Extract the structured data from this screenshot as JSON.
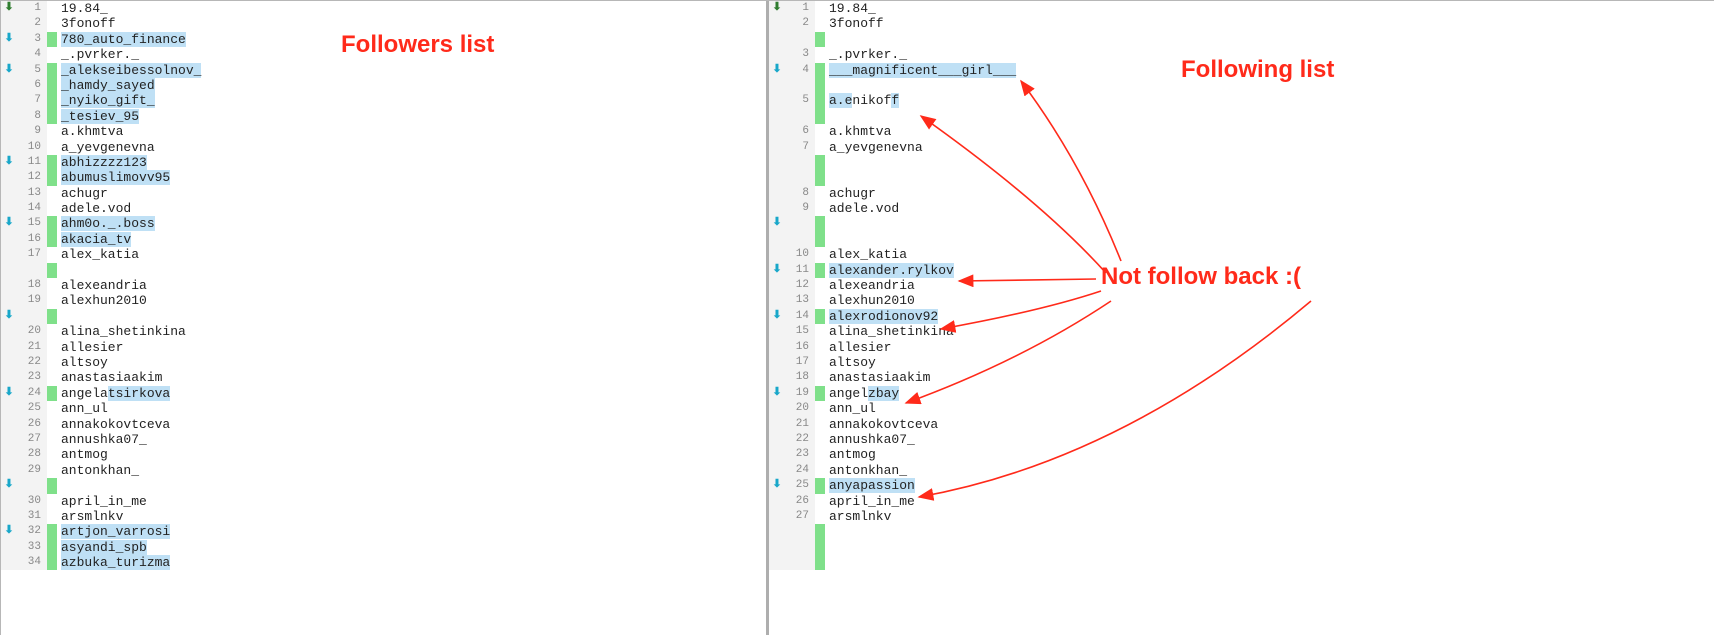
{
  "annotations": {
    "followers_title": "Followers list",
    "following_title": "Following list",
    "not_follow_back": "Not follow back :("
  },
  "left": {
    "rows": [
      {
        "n": 1,
        "mark": "down-green",
        "bar": false,
        "segs": [
          [
            "19.84_",
            false
          ]
        ]
      },
      {
        "n": 2,
        "mark": "",
        "bar": false,
        "segs": [
          [
            "3fonoff",
            false
          ]
        ]
      },
      {
        "n": 3,
        "mark": "down-cyan",
        "bar": true,
        "segs": [
          [
            "780_auto_finance",
            true
          ]
        ]
      },
      {
        "n": 4,
        "mark": "",
        "bar": false,
        "segs": [
          [
            "_.pvrker._",
            false
          ]
        ]
      },
      {
        "n": 5,
        "mark": "down-cyan",
        "bar": true,
        "segs": [
          [
            "_alekseibessolnov_",
            true
          ]
        ]
      },
      {
        "n": 6,
        "mark": "",
        "bar": true,
        "segs": [
          [
            "_hamdy_sayed",
            true
          ]
        ]
      },
      {
        "n": 7,
        "mark": "",
        "bar": true,
        "segs": [
          [
            "_nyiko_gift_",
            true
          ]
        ]
      },
      {
        "n": 8,
        "mark": "",
        "bar": true,
        "segs": [
          [
            "_tesiev_95",
            true
          ]
        ]
      },
      {
        "n": 9,
        "mark": "",
        "bar": false,
        "segs": [
          [
            "a.khmtva",
            false
          ]
        ]
      },
      {
        "n": 10,
        "mark": "",
        "bar": false,
        "segs": [
          [
            "a_yevgenevna",
            false
          ]
        ]
      },
      {
        "n": 11,
        "mark": "down-cyan",
        "bar": true,
        "segs": [
          [
            "abhizzzz123",
            true
          ]
        ]
      },
      {
        "n": 12,
        "mark": "",
        "bar": true,
        "segs": [
          [
            "abumuslimovv95",
            true
          ]
        ]
      },
      {
        "n": 13,
        "mark": "",
        "bar": false,
        "segs": [
          [
            "achugr",
            false
          ]
        ]
      },
      {
        "n": 14,
        "mark": "",
        "bar": false,
        "segs": [
          [
            "adele.vod",
            false
          ]
        ]
      },
      {
        "n": 15,
        "mark": "down-cyan",
        "bar": true,
        "segs": [
          [
            "ahm0o._.boss",
            true
          ]
        ]
      },
      {
        "n": 16,
        "mark": "",
        "bar": true,
        "segs": [
          [
            "akacia_tv",
            true
          ]
        ]
      },
      {
        "n": 17,
        "mark": "",
        "bar": false,
        "segs": [
          [
            "alex_katia",
            false
          ]
        ]
      },
      {
        "n": -1,
        "mark": "",
        "bar": true,
        "segs": [
          [
            "",
            false
          ]
        ]
      },
      {
        "n": 18,
        "mark": "",
        "bar": false,
        "segs": [
          [
            "alexeandria",
            false
          ]
        ]
      },
      {
        "n": 19,
        "mark": "",
        "bar": false,
        "segs": [
          [
            "alexhun2010",
            false
          ]
        ]
      },
      {
        "n": -1,
        "mark": "down-cyan",
        "bar": true,
        "segs": [
          [
            "",
            false
          ]
        ]
      },
      {
        "n": 20,
        "mark": "",
        "bar": false,
        "segs": [
          [
            "alina_shetinkina",
            false
          ]
        ]
      },
      {
        "n": 21,
        "mark": "",
        "bar": false,
        "segs": [
          [
            "allesier",
            false
          ]
        ]
      },
      {
        "n": 22,
        "mark": "",
        "bar": false,
        "segs": [
          [
            "altsoy",
            false
          ]
        ]
      },
      {
        "n": 23,
        "mark": "",
        "bar": false,
        "segs": [
          [
            "anastasiaakim",
            false
          ]
        ]
      },
      {
        "n": 24,
        "mark": "down-cyan",
        "bar": true,
        "segs": [
          [
            "angela",
            false
          ],
          [
            "tsirkova",
            true
          ]
        ]
      },
      {
        "n": 25,
        "mark": "",
        "bar": false,
        "segs": [
          [
            "ann_ul",
            false
          ]
        ]
      },
      {
        "n": 26,
        "mark": "",
        "bar": false,
        "segs": [
          [
            "annakokovtceva",
            false
          ]
        ]
      },
      {
        "n": 27,
        "mark": "",
        "bar": false,
        "segs": [
          [
            "annushka07_",
            false
          ]
        ]
      },
      {
        "n": 28,
        "mark": "",
        "bar": false,
        "segs": [
          [
            "antmog",
            false
          ]
        ]
      },
      {
        "n": 29,
        "mark": "",
        "bar": false,
        "segs": [
          [
            "antonkhan_",
            false
          ]
        ]
      },
      {
        "n": -1,
        "mark": "down-cyan",
        "bar": true,
        "segs": [
          [
            "",
            false
          ]
        ]
      },
      {
        "n": 30,
        "mark": "",
        "bar": false,
        "segs": [
          [
            "april_in_me",
            false
          ]
        ]
      },
      {
        "n": 31,
        "mark": "",
        "bar": false,
        "segs": [
          [
            "arsmlnkv",
            false
          ]
        ]
      },
      {
        "n": 32,
        "mark": "down-cyan",
        "bar": true,
        "segs": [
          [
            "artjon_varrosi",
            true
          ]
        ]
      },
      {
        "n": 33,
        "mark": "",
        "bar": true,
        "segs": [
          [
            "asyandi_spb",
            true
          ]
        ]
      },
      {
        "n": 34,
        "mark": "",
        "bar": true,
        "segs": [
          [
            "azbuka_turizma",
            true
          ]
        ]
      }
    ]
  },
  "right": {
    "rows": [
      {
        "n": 1,
        "mark": "down-green",
        "bar": false,
        "segs": [
          [
            "19.84_",
            false
          ]
        ]
      },
      {
        "n": 2,
        "mark": "",
        "bar": false,
        "segs": [
          [
            "3fonoff",
            false
          ]
        ]
      },
      {
        "n": -1,
        "mark": "",
        "bar": true,
        "segs": [
          [
            "",
            false
          ]
        ]
      },
      {
        "n": 3,
        "mark": "",
        "bar": false,
        "segs": [
          [
            "_.pvrker._",
            false
          ]
        ]
      },
      {
        "n": 4,
        "mark": "down-cyan",
        "bar": true,
        "segs": [
          [
            "___magnificent___girl___",
            true
          ]
        ]
      },
      {
        "n": -1,
        "mark": "",
        "bar": true,
        "segs": [
          [
            "",
            false
          ]
        ]
      },
      {
        "n": 5,
        "mark": "",
        "bar": true,
        "segs": [
          [
            "a.e",
            true
          ],
          [
            "nikof",
            false
          ],
          [
            "f",
            true
          ]
        ]
      },
      {
        "n": -1,
        "mark": "",
        "bar": true,
        "segs": [
          [
            "",
            false
          ]
        ]
      },
      {
        "n": 6,
        "mark": "",
        "bar": false,
        "segs": [
          [
            "a.khmtva",
            false
          ]
        ]
      },
      {
        "n": 7,
        "mark": "",
        "bar": false,
        "segs": [
          [
            "a_yevgenevna",
            false
          ]
        ]
      },
      {
        "n": -1,
        "mark": "",
        "bar": true,
        "segs": [
          [
            "",
            false
          ]
        ]
      },
      {
        "n": -1,
        "mark": "",
        "bar": true,
        "segs": [
          [
            "",
            false
          ]
        ]
      },
      {
        "n": 8,
        "mark": "",
        "bar": false,
        "segs": [
          [
            "achugr",
            false
          ]
        ]
      },
      {
        "n": 9,
        "mark": "",
        "bar": false,
        "segs": [
          [
            "adele.vod",
            false
          ]
        ]
      },
      {
        "n": -1,
        "mark": "down-cyan",
        "bar": true,
        "segs": [
          [
            "",
            false
          ]
        ]
      },
      {
        "n": -1,
        "mark": "",
        "bar": true,
        "segs": [
          [
            "",
            false
          ]
        ]
      },
      {
        "n": 10,
        "mark": "",
        "bar": false,
        "segs": [
          [
            "alex_katia",
            false
          ]
        ]
      },
      {
        "n": 11,
        "mark": "down-cyan",
        "bar": true,
        "segs": [
          [
            "alexander.rylkov",
            true
          ]
        ]
      },
      {
        "n": 12,
        "mark": "",
        "bar": false,
        "segs": [
          [
            "alexeandria",
            false
          ]
        ]
      },
      {
        "n": 13,
        "mark": "",
        "bar": false,
        "segs": [
          [
            "alexhun2010",
            false
          ]
        ]
      },
      {
        "n": 14,
        "mark": "down-cyan",
        "bar": true,
        "segs": [
          [
            "alexrodionov92",
            true
          ]
        ]
      },
      {
        "n": 15,
        "mark": "",
        "bar": false,
        "segs": [
          [
            "alina_shetinkina",
            false
          ]
        ]
      },
      {
        "n": 16,
        "mark": "",
        "bar": false,
        "segs": [
          [
            "allesier",
            false
          ]
        ]
      },
      {
        "n": 17,
        "mark": "",
        "bar": false,
        "segs": [
          [
            "altsoy",
            false
          ]
        ]
      },
      {
        "n": 18,
        "mark": "",
        "bar": false,
        "segs": [
          [
            "anastasiaakim",
            false
          ]
        ]
      },
      {
        "n": 19,
        "mark": "down-cyan",
        "bar": true,
        "segs": [
          [
            "angel",
            false
          ],
          [
            "zbay",
            true
          ]
        ]
      },
      {
        "n": 20,
        "mark": "",
        "bar": false,
        "segs": [
          [
            "ann_ul",
            false
          ]
        ]
      },
      {
        "n": 21,
        "mark": "",
        "bar": false,
        "segs": [
          [
            "annakokovtceva",
            false
          ]
        ]
      },
      {
        "n": 22,
        "mark": "",
        "bar": false,
        "segs": [
          [
            "annushka07_",
            false
          ]
        ]
      },
      {
        "n": 23,
        "mark": "",
        "bar": false,
        "segs": [
          [
            "antmog",
            false
          ]
        ]
      },
      {
        "n": 24,
        "mark": "",
        "bar": false,
        "segs": [
          [
            "antonkhan_",
            false
          ]
        ]
      },
      {
        "n": 25,
        "mark": "down-cyan",
        "bar": true,
        "segs": [
          [
            "anyapassion",
            true
          ]
        ]
      },
      {
        "n": 26,
        "mark": "",
        "bar": false,
        "segs": [
          [
            "april_in_me",
            false
          ]
        ]
      },
      {
        "n": 27,
        "mark": "",
        "bar": false,
        "segs": [
          [
            "arsmlnkv",
            false
          ]
        ]
      },
      {
        "n": -1,
        "mark": "",
        "bar": true,
        "segs": [
          [
            "",
            false
          ]
        ]
      },
      {
        "n": -1,
        "mark": "",
        "bar": true,
        "segs": [
          [
            "",
            false
          ]
        ]
      },
      {
        "n": -1,
        "mark": "",
        "bar": true,
        "segs": [
          [
            "",
            false
          ]
        ]
      }
    ]
  }
}
